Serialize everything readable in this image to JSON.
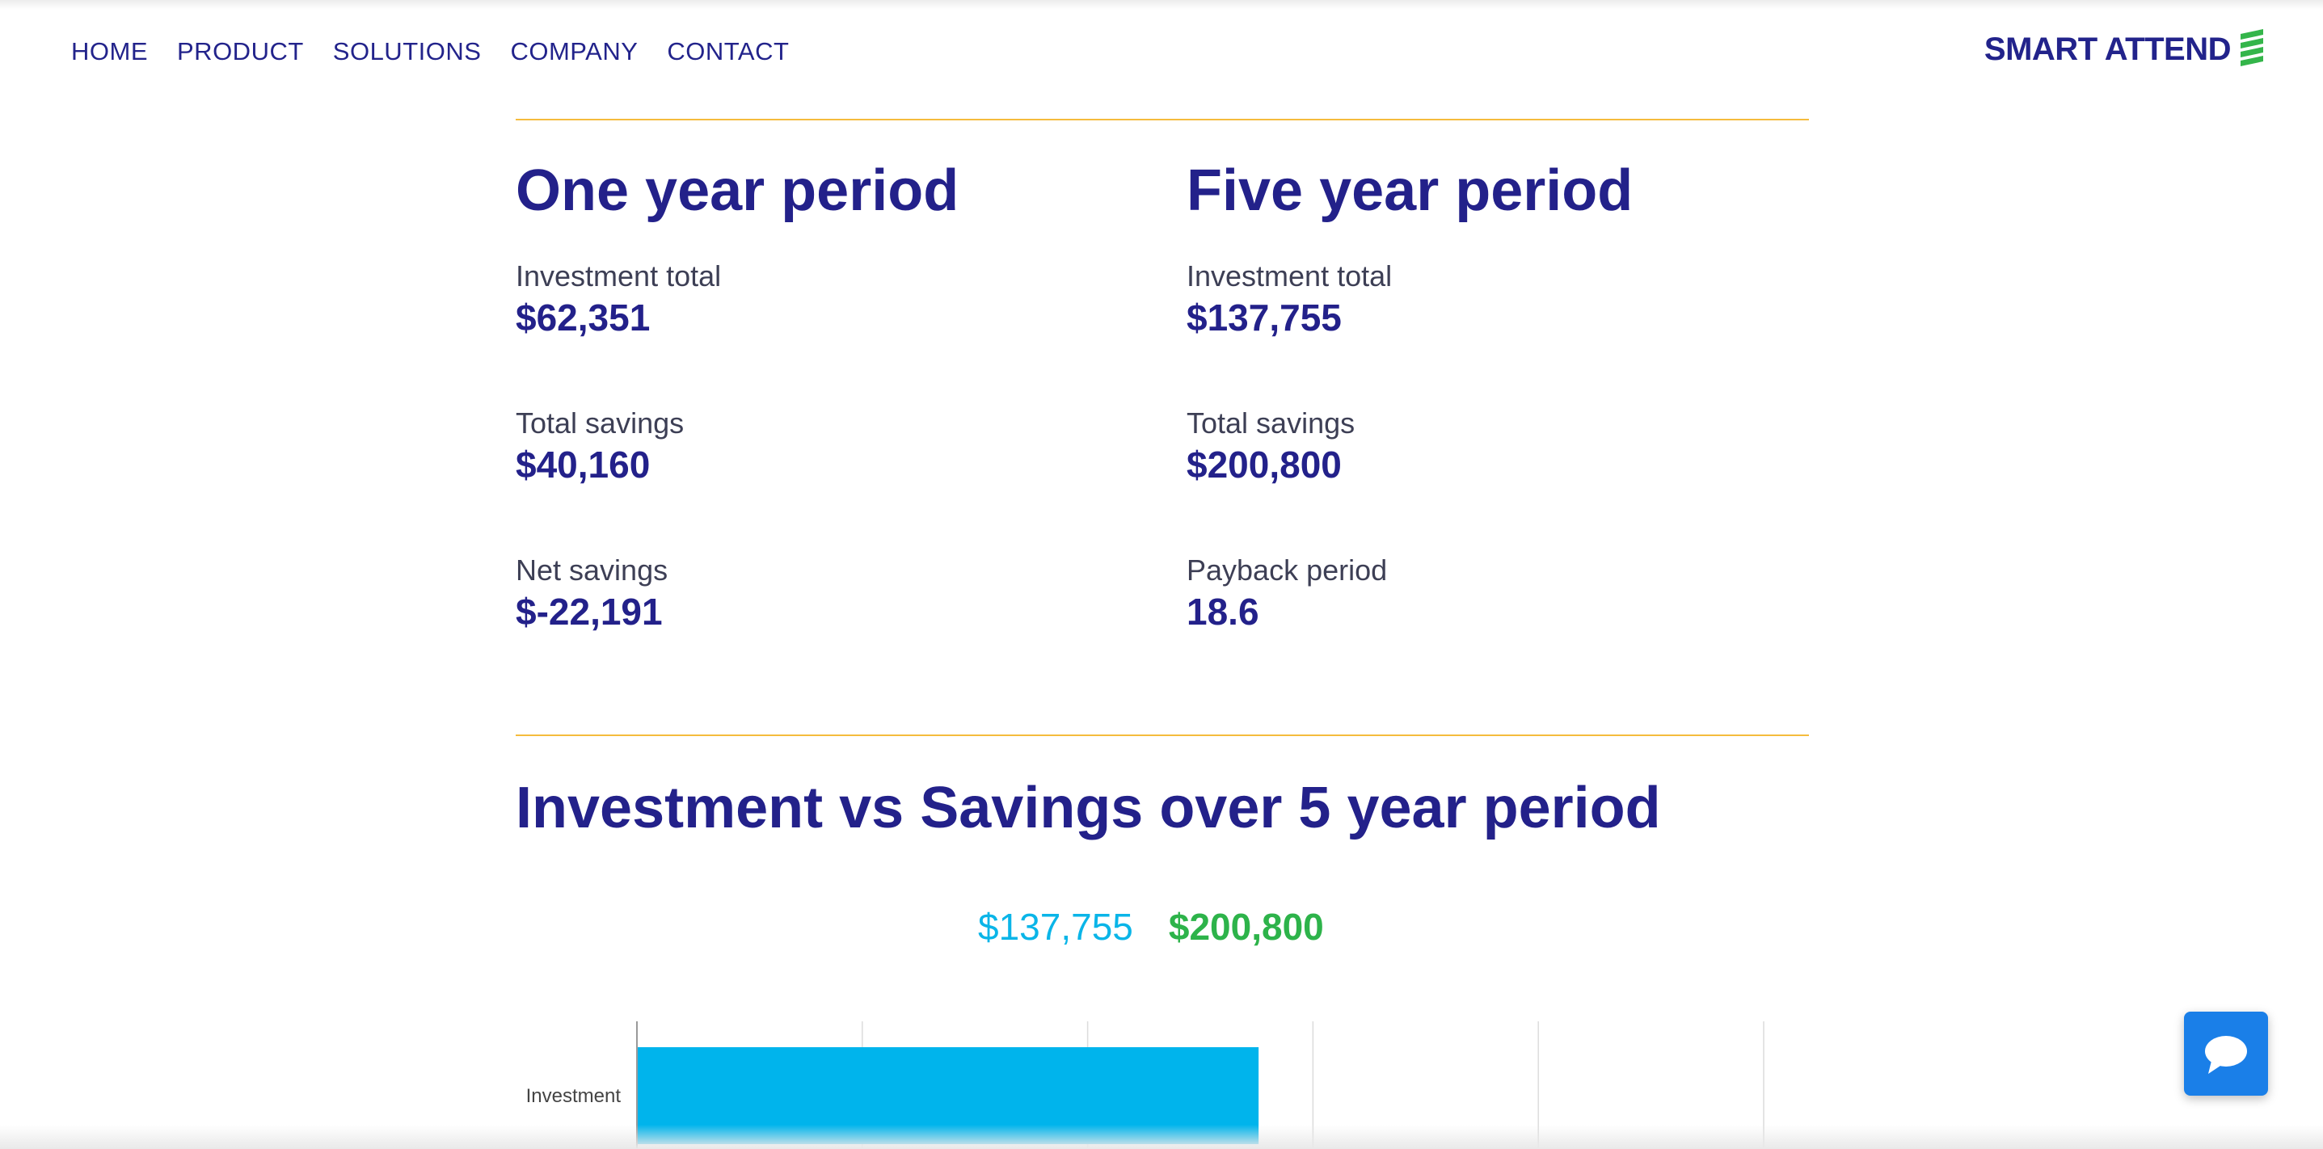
{
  "nav": {
    "items": [
      "HOME",
      "PRODUCT",
      "SOLUTIONS",
      "COMPANY",
      "CONTACT"
    ]
  },
  "logo": {
    "text": "SMART ATTEND",
    "mark_icon": "stacked-bars-icon"
  },
  "one_year": {
    "title": "One year period",
    "stats": [
      {
        "label": "Investment total",
        "value": "$62,351"
      },
      {
        "label": "Total savings",
        "value": "$40,160"
      },
      {
        "label": "Net savings",
        "value": "$-22,191"
      }
    ]
  },
  "five_year": {
    "title": "Five year period",
    "stats": [
      {
        "label": "Investment total",
        "value": "$137,755"
      },
      {
        "label": "Total savings",
        "value": "$200,800"
      },
      {
        "label": "Payback period",
        "value": "18.6"
      }
    ]
  },
  "chart_section": {
    "title": "Investment vs Savings over 5 year period",
    "legend": {
      "investment": "$137,755",
      "savings": "$200,800"
    }
  },
  "chat": {
    "icon": "chat-bubble-icon"
  },
  "colors": {
    "brand": "#23218a",
    "accent_rule": "#f5bc3d",
    "investment": "#00b4ec",
    "savings": "#2db34a",
    "chat": "#1a7fe8"
  },
  "chart_data": {
    "type": "bar",
    "orientation": "horizontal",
    "categories": [
      "Investment"
    ],
    "series": [
      {
        "name": "Investment",
        "values": [
          137755
        ]
      }
    ],
    "xlim": [
      0,
      250000
    ],
    "grid": true
  }
}
